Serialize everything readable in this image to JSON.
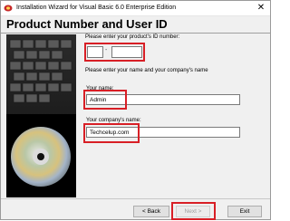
{
  "window": {
    "title": "Installation Wizard for Visual Basic 6.0 Enterprise Edition",
    "close_glyph": "✕"
  },
  "header": {
    "title": "Product Number and User ID"
  },
  "form": {
    "id_prompt": "Please enter your product's ID number:",
    "id_part1": "",
    "id_separator": "-",
    "id_part2": "",
    "name_prompt": "Please enter your name and your company's name",
    "name_label": "Your name:",
    "name_value": "Admin",
    "company_label": "Your company's name:",
    "company_value": "Techcelup.com"
  },
  "footer": {
    "back_label": "< Back",
    "next_label": "Next >",
    "exit_label": "Exit"
  },
  "colors": {
    "highlight": "#d81f26",
    "dialog_bg": "#f0f0f0"
  },
  "icons": {
    "app": "vb-wizard-icon",
    "close": "close-icon"
  }
}
